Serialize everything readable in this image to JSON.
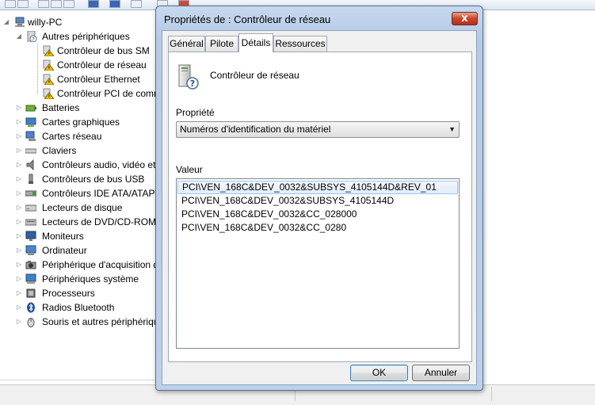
{
  "tree": {
    "root": "willy-PC",
    "expanded_category": "Autres périphériques",
    "expanded_children": [
      "Contrôleur de bus SM",
      "Contrôleur de réseau",
      "Contrôleur Ethernet",
      "Contrôleur PCI de comm"
    ],
    "categories": [
      {
        "label": "Batteries",
        "icon": "battery-icon"
      },
      {
        "label": "Cartes graphiques",
        "icon": "display-adapter-icon"
      },
      {
        "label": "Cartes réseau",
        "icon": "network-adapter-icon"
      },
      {
        "label": "Claviers",
        "icon": "keyboard-icon"
      },
      {
        "label": "Contrôleurs audio, vidéo et",
        "icon": "speaker-icon"
      },
      {
        "label": "Contrôleurs de bus USB",
        "icon": "usb-icon"
      },
      {
        "label": "Contrôleurs IDE ATA/ATAP",
        "icon": "ide-controller-icon"
      },
      {
        "label": "Lecteurs de disque",
        "icon": "disk-drive-icon"
      },
      {
        "label": "Lecteurs de DVD/CD-ROM",
        "icon": "dvd-drive-icon"
      },
      {
        "label": "Moniteurs",
        "icon": "monitor-icon"
      },
      {
        "label": "Ordinateur",
        "icon": "computer-icon"
      },
      {
        "label": "Périphérique d'acquisition d",
        "icon": "imaging-device-icon"
      },
      {
        "label": "Périphériques système",
        "icon": "system-device-icon"
      },
      {
        "label": "Processeurs",
        "icon": "processor-icon"
      },
      {
        "label": "Radios Bluetooth",
        "icon": "bluetooth-icon"
      },
      {
        "label": "Souris et autres périphériqu",
        "icon": "mouse-icon"
      }
    ]
  },
  "dialog": {
    "title": "Propriétés de : Contrôleur de réseau",
    "close_symbol": "x",
    "tabs": [
      "Général",
      "Pilote",
      "Détails",
      "Ressources"
    ],
    "active_tab": "Détails",
    "device_name": "Contrôleur de réseau",
    "property_label": "Propriété",
    "property_selected": "Numéros d'identification du matériel",
    "value_label": "Valeur",
    "values": [
      "PCI\\VEN_168C&DEV_0032&SUBSYS_4105144D&REV_01",
      "PCI\\VEN_168C&DEV_0032&SUBSYS_4105144D",
      "PCI\\VEN_168C&DEV_0032&CC_028000",
      "PCI\\VEN_168C&DEV_0032&CC_0280"
    ],
    "ok_label": "OK",
    "cancel_label": "Annuler"
  },
  "colors": {
    "dialog_frame": "#bcd0ea",
    "close_button": "#c9442a",
    "selection": "#e1edfb",
    "warning": "#f2c200"
  }
}
